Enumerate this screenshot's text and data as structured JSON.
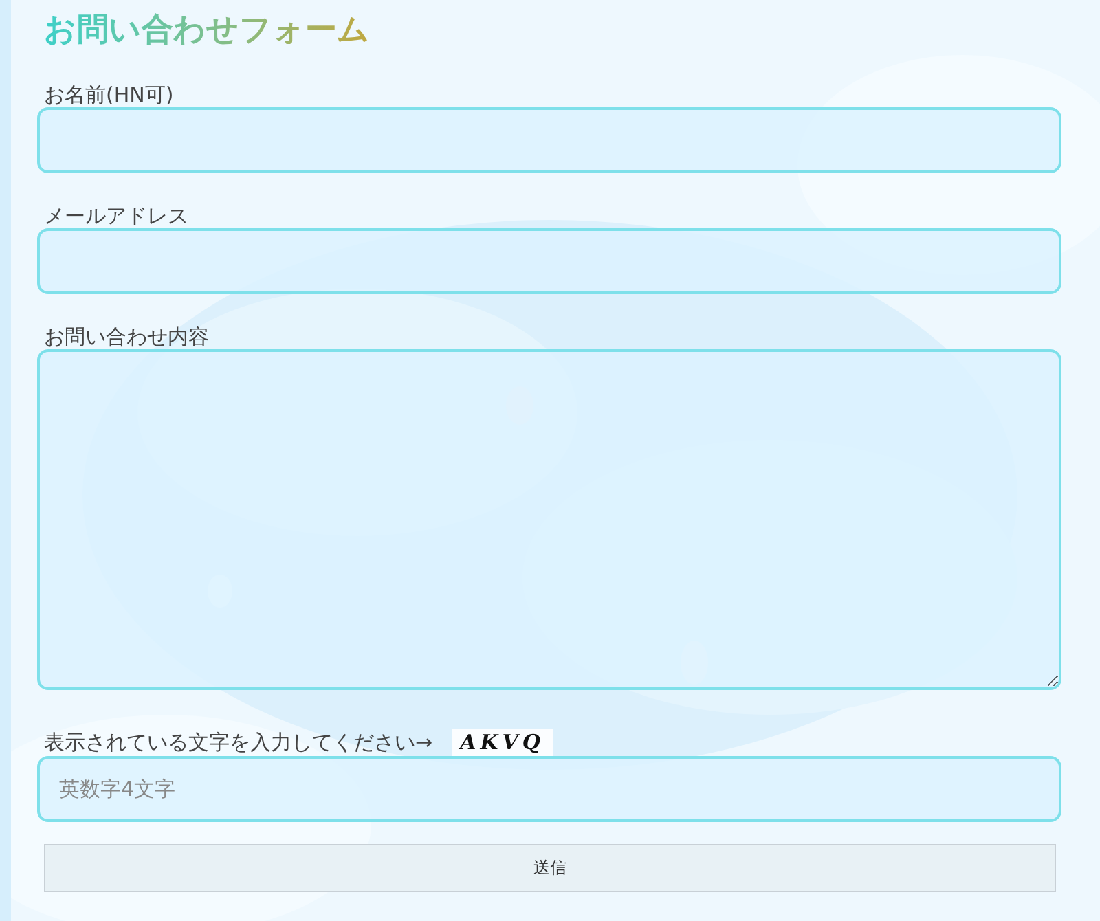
{
  "title": "お問い合わせフォーム",
  "fields": [
    {
      "kind": "input",
      "label": "お名前(HN可)"
    },
    {
      "kind": "input",
      "label": "メールアドレス"
    },
    {
      "kind": "textarea",
      "label": "お問い合わせ内容"
    }
  ],
  "captcha": {
    "label": "表示されている文字を入力してください→",
    "code": "AKVQ",
    "placeholder": "英数字4文字"
  },
  "submit": "送信"
}
